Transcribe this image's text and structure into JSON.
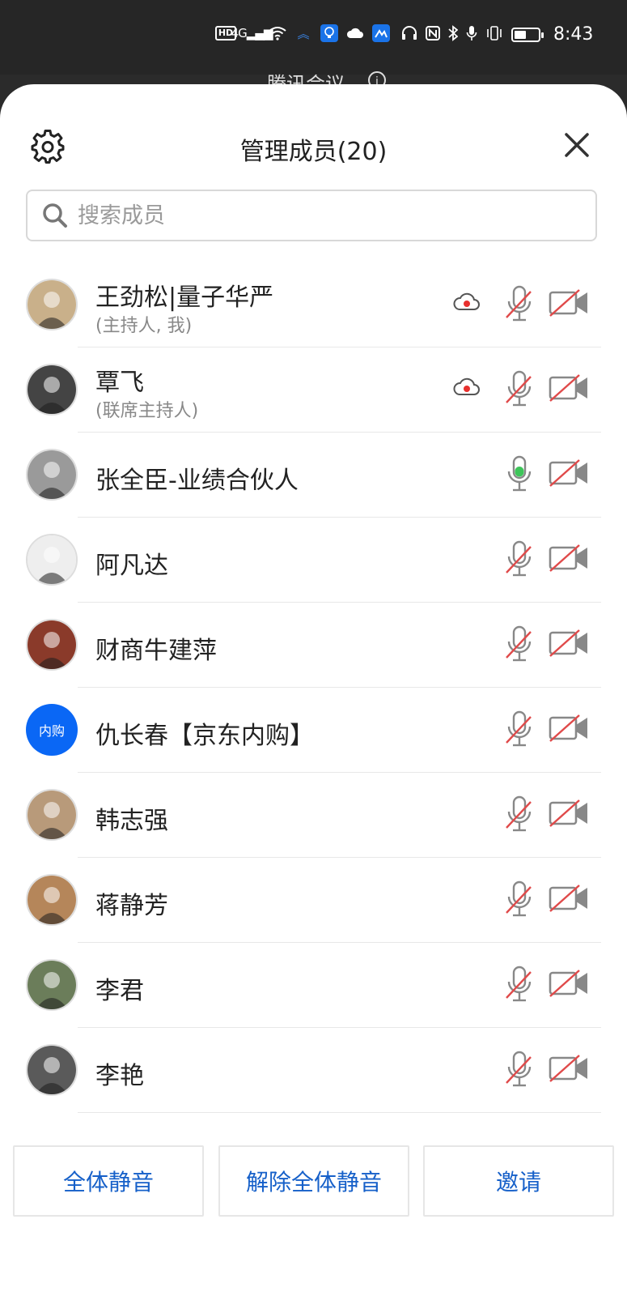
{
  "status_bar": {
    "time": "8:43",
    "icons": [
      "hd-icon",
      "4g-signal-icon",
      "wifi-icon",
      "notification-icon",
      "bulb-app-icon",
      "cloud-icon",
      "app-icon",
      "headphones-icon",
      "nfc-icon",
      "bluetooth-icon",
      "microphone-icon",
      "vibrate-icon",
      "battery-icon"
    ],
    "hd_label": "HD",
    "signal_label": "4G"
  },
  "background_app": {
    "title": "腾讯会议",
    "info_label": "i"
  },
  "panel": {
    "title": "管理成员(20)",
    "search_placeholder": "搜索成员"
  },
  "members": [
    {
      "name": "王劲松|量子华严",
      "role": "(主持人, 我)",
      "recording": true,
      "mic": "muted",
      "camera": "off",
      "avatar": "photo"
    },
    {
      "name": "覃飞",
      "role": "(联席主持人)",
      "recording": true,
      "mic": "muted",
      "camera": "off",
      "avatar": "photo"
    },
    {
      "name": "张全臣-业绩合伙人",
      "role": "",
      "recording": false,
      "mic": "active",
      "camera": "off",
      "avatar": "photo"
    },
    {
      "name": "阿凡达",
      "role": "",
      "recording": false,
      "mic": "muted",
      "camera": "off",
      "avatar": "photo"
    },
    {
      "name": "财商牛建萍",
      "role": "",
      "recording": false,
      "mic": "muted",
      "camera": "off",
      "avatar": "photo"
    },
    {
      "name": "仇长春【京东内购】",
      "role": "",
      "recording": false,
      "mic": "muted",
      "camera": "off",
      "avatar": "text",
      "avatar_text": "内购"
    },
    {
      "name": "韩志强",
      "role": "",
      "recording": false,
      "mic": "muted",
      "camera": "off",
      "avatar": "photo"
    },
    {
      "name": "蒋静芳",
      "role": "",
      "recording": false,
      "mic": "muted",
      "camera": "off",
      "avatar": "photo"
    },
    {
      "name": "李君",
      "role": "",
      "recording": false,
      "mic": "muted",
      "camera": "off",
      "avatar": "photo"
    },
    {
      "name": "李艳",
      "role": "",
      "recording": false,
      "mic": "muted",
      "camera": "off",
      "avatar": "photo"
    }
  ],
  "footer": {
    "mute_all": "全体静音",
    "unmute_all": "解除全体静音",
    "invite": "邀请"
  },
  "colors": {
    "accent": "#1660c9",
    "mute_slash": "#e04a4a",
    "active_mic": "#3ec55a",
    "record_dot": "#e8302e",
    "avatar_blue": "#0a67f5"
  }
}
